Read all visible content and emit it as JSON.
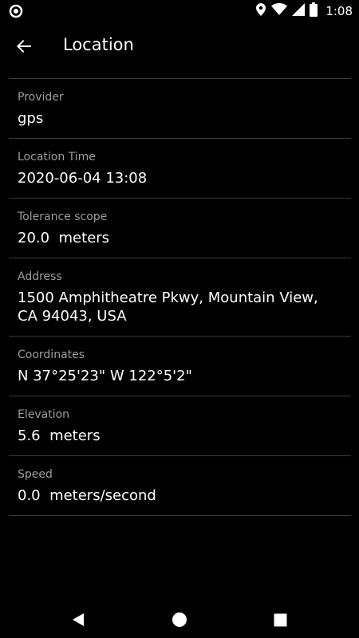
{
  "status_bar": {
    "time": "1:08",
    "icons": [
      "sync-icon",
      "location-icon",
      "wifi-icon",
      "signal-icon",
      "battery-icon"
    ]
  },
  "header": {
    "title": "Location",
    "back_icon": "back-arrow-icon"
  },
  "items": [
    {
      "label": "Provider",
      "value": "gps"
    },
    {
      "label": "Location Time",
      "value": "2020-06-04 13:08"
    },
    {
      "label": "Tolerance scope",
      "value": "20.0  meters"
    },
    {
      "label": "Address",
      "value": "1500 Amphitheatre Pkwy, Mountain View,\nCA 94043, USA"
    },
    {
      "label": "Coordinates",
      "value": "N 37°25'23\" W 122°5'2\""
    },
    {
      "label": "Elevation",
      "value": "5.6  meters"
    },
    {
      "label": "Speed",
      "value": "0.0  meters/second"
    }
  ],
  "nav_bar": {
    "icons": [
      "nav-back-icon",
      "nav-home-icon",
      "nav-recents-icon"
    ]
  },
  "colors": {
    "background": "#000000",
    "text": "#ffffff",
    "label": "#9d9d9d",
    "divider": "#3a3a3a"
  }
}
